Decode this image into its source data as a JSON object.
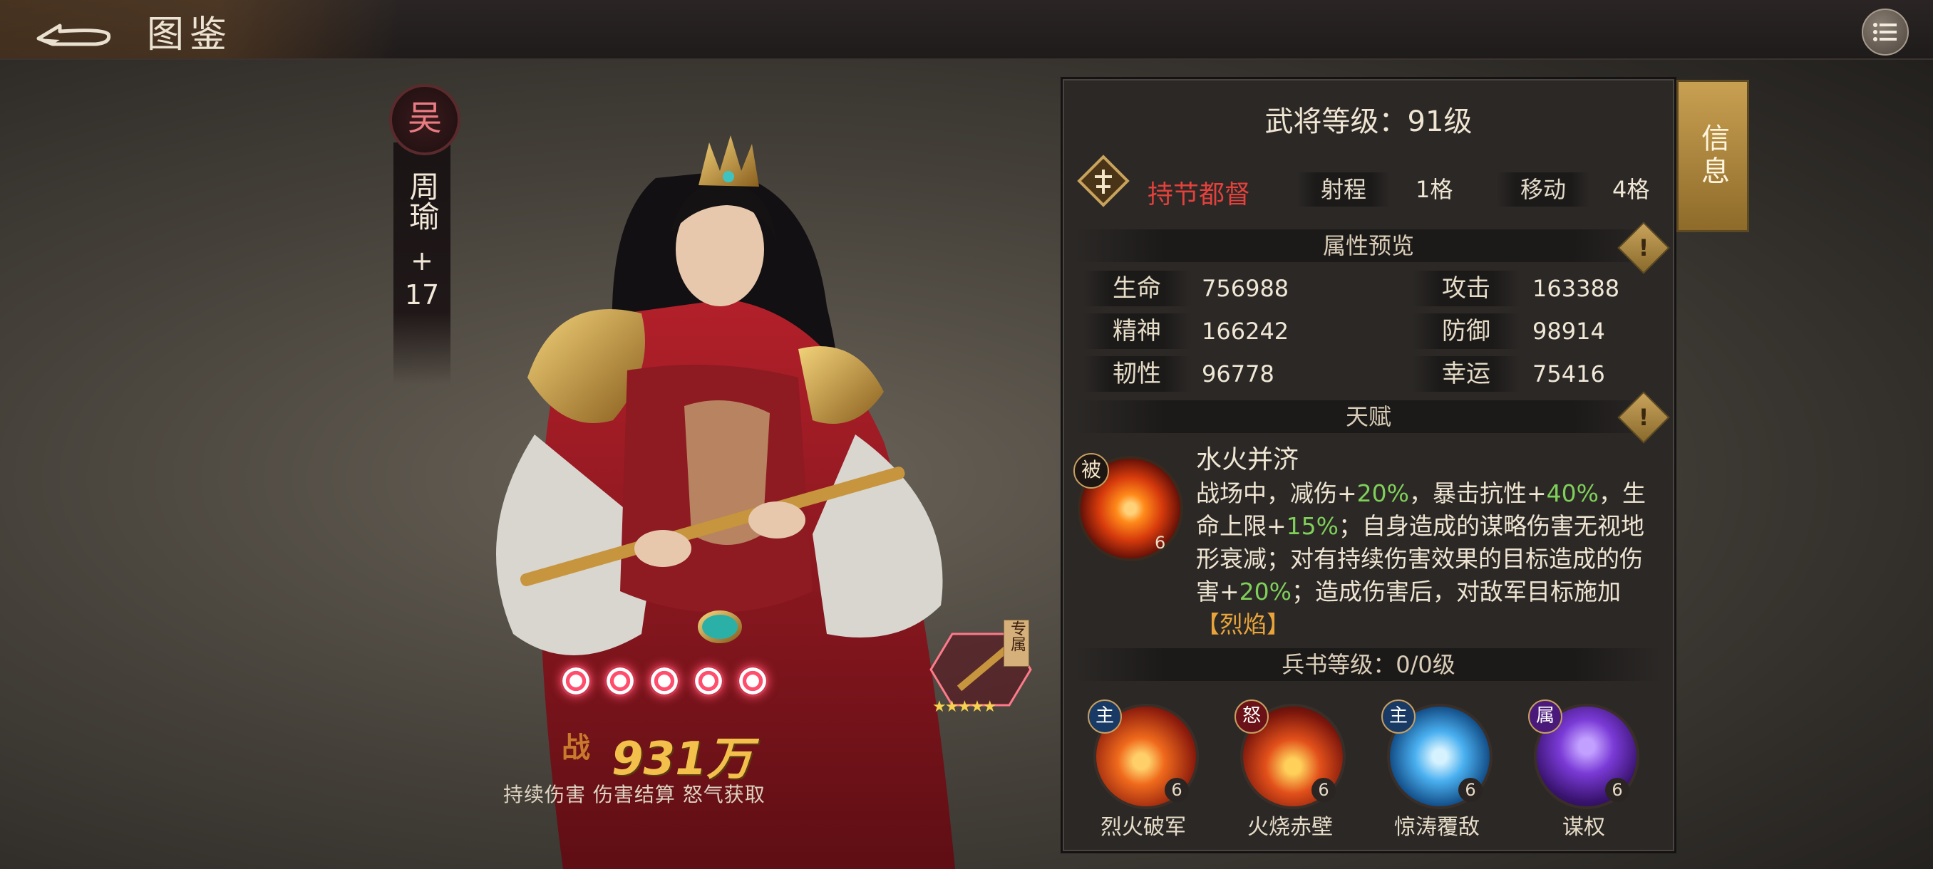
{
  "header": {
    "title": "图鉴",
    "back_icon": "back-arrow-icon",
    "menu_icon": "list-menu-icon"
  },
  "general": {
    "faction": "吴",
    "name": "周瑜",
    "plus": "+",
    "rank": "17",
    "power_label": "战",
    "power": "931万",
    "tags": "持续伤害 伤害结算 怒气获取",
    "exclusive_tag": "专属",
    "weapon_stars": "★★★★★",
    "awaken_rings": 5
  },
  "panel": {
    "level_text": "武将等级：91级",
    "info_tab": "信息",
    "role": "持节都督",
    "range_label": "射程",
    "range_value": "1格",
    "move_label": "移动",
    "move_value": "4格",
    "attr_header": "属性预览",
    "attributes": [
      {
        "label": "生命",
        "value": "756988"
      },
      {
        "label": "攻击",
        "value": "163388"
      },
      {
        "label": "精神",
        "value": "166242"
      },
      {
        "label": "防御",
        "value": "98914"
      },
      {
        "label": "韧性",
        "value": "96778"
      },
      {
        "label": "幸运",
        "value": "75416"
      }
    ],
    "talent_header": "天赋",
    "talent": {
      "badge": "被",
      "level": "6",
      "name": "水火并济",
      "desc_parts": [
        "战场中，减伤+",
        "20%",
        "，暴击抗性+",
        "40%",
        "，生命上限+",
        "15%",
        "；自身造成的谋略伤害无视地形衰减；对有持续伤害效果的目标造成的伤害+",
        "20%",
        "；造成伤害后，对敌军目标施加",
        "【烈焰】"
      ]
    },
    "book_header": "兵书等级：0/0级",
    "skills": [
      {
        "badge": "主",
        "name": "烈火破军",
        "level": "6"
      },
      {
        "badge": "怒",
        "name": "火烧赤壁",
        "level": "6"
      },
      {
        "badge": "主",
        "name": "惊涛覆敌",
        "level": "6"
      },
      {
        "badge": "属",
        "name": "谋权",
        "level": "6"
      }
    ]
  },
  "colors": {
    "accent_gold": "#c9a052",
    "role_red": "#e2413c",
    "buff_green": "#7fd05a",
    "power_gold": "#f3c04c"
  }
}
